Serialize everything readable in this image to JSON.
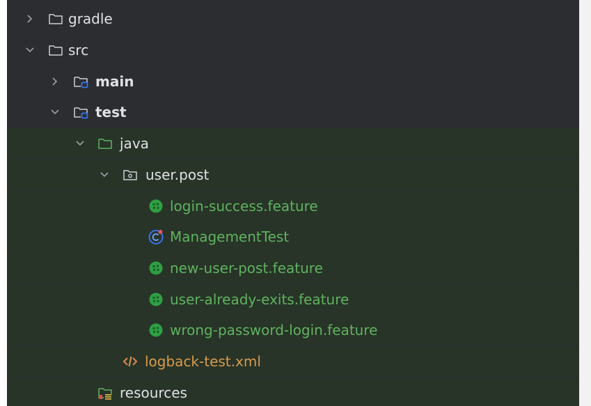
{
  "project_tree": {
    "items": [
      {
        "label": "gradle",
        "expanded": false
      },
      {
        "label": "src",
        "expanded": true
      },
      {
        "label": "main",
        "expanded": false
      },
      {
        "label": "test",
        "expanded": true
      },
      {
        "label": "java",
        "expanded": true
      },
      {
        "label": "user.post",
        "expanded": true
      },
      {
        "label": "login-success.feature"
      },
      {
        "label": "ManagementTest"
      },
      {
        "label": "new-user-post.feature"
      },
      {
        "label": "user-already-exits.feature"
      },
      {
        "label": "wrong-password-login.feature"
      },
      {
        "label": "logback-test.xml"
      },
      {
        "label": "resources"
      }
    ]
  },
  "icons": {
    "folder": "folder-icon",
    "module": "module-folder-icon",
    "package": "package-icon",
    "feature": "cucumber-feature-icon",
    "class": "test-class-icon",
    "xml": "xml-file-icon",
    "resources": "resources-folder-icon"
  },
  "colors": {
    "panel_bg": "#2b2d30",
    "test_scope_bg": "#283428",
    "text": "#dfe1e5",
    "test_text": "#5fb35f",
    "xml_text": "#d99b4b",
    "module_accent": "#3574f0",
    "feature_icon": "#2ea043"
  }
}
